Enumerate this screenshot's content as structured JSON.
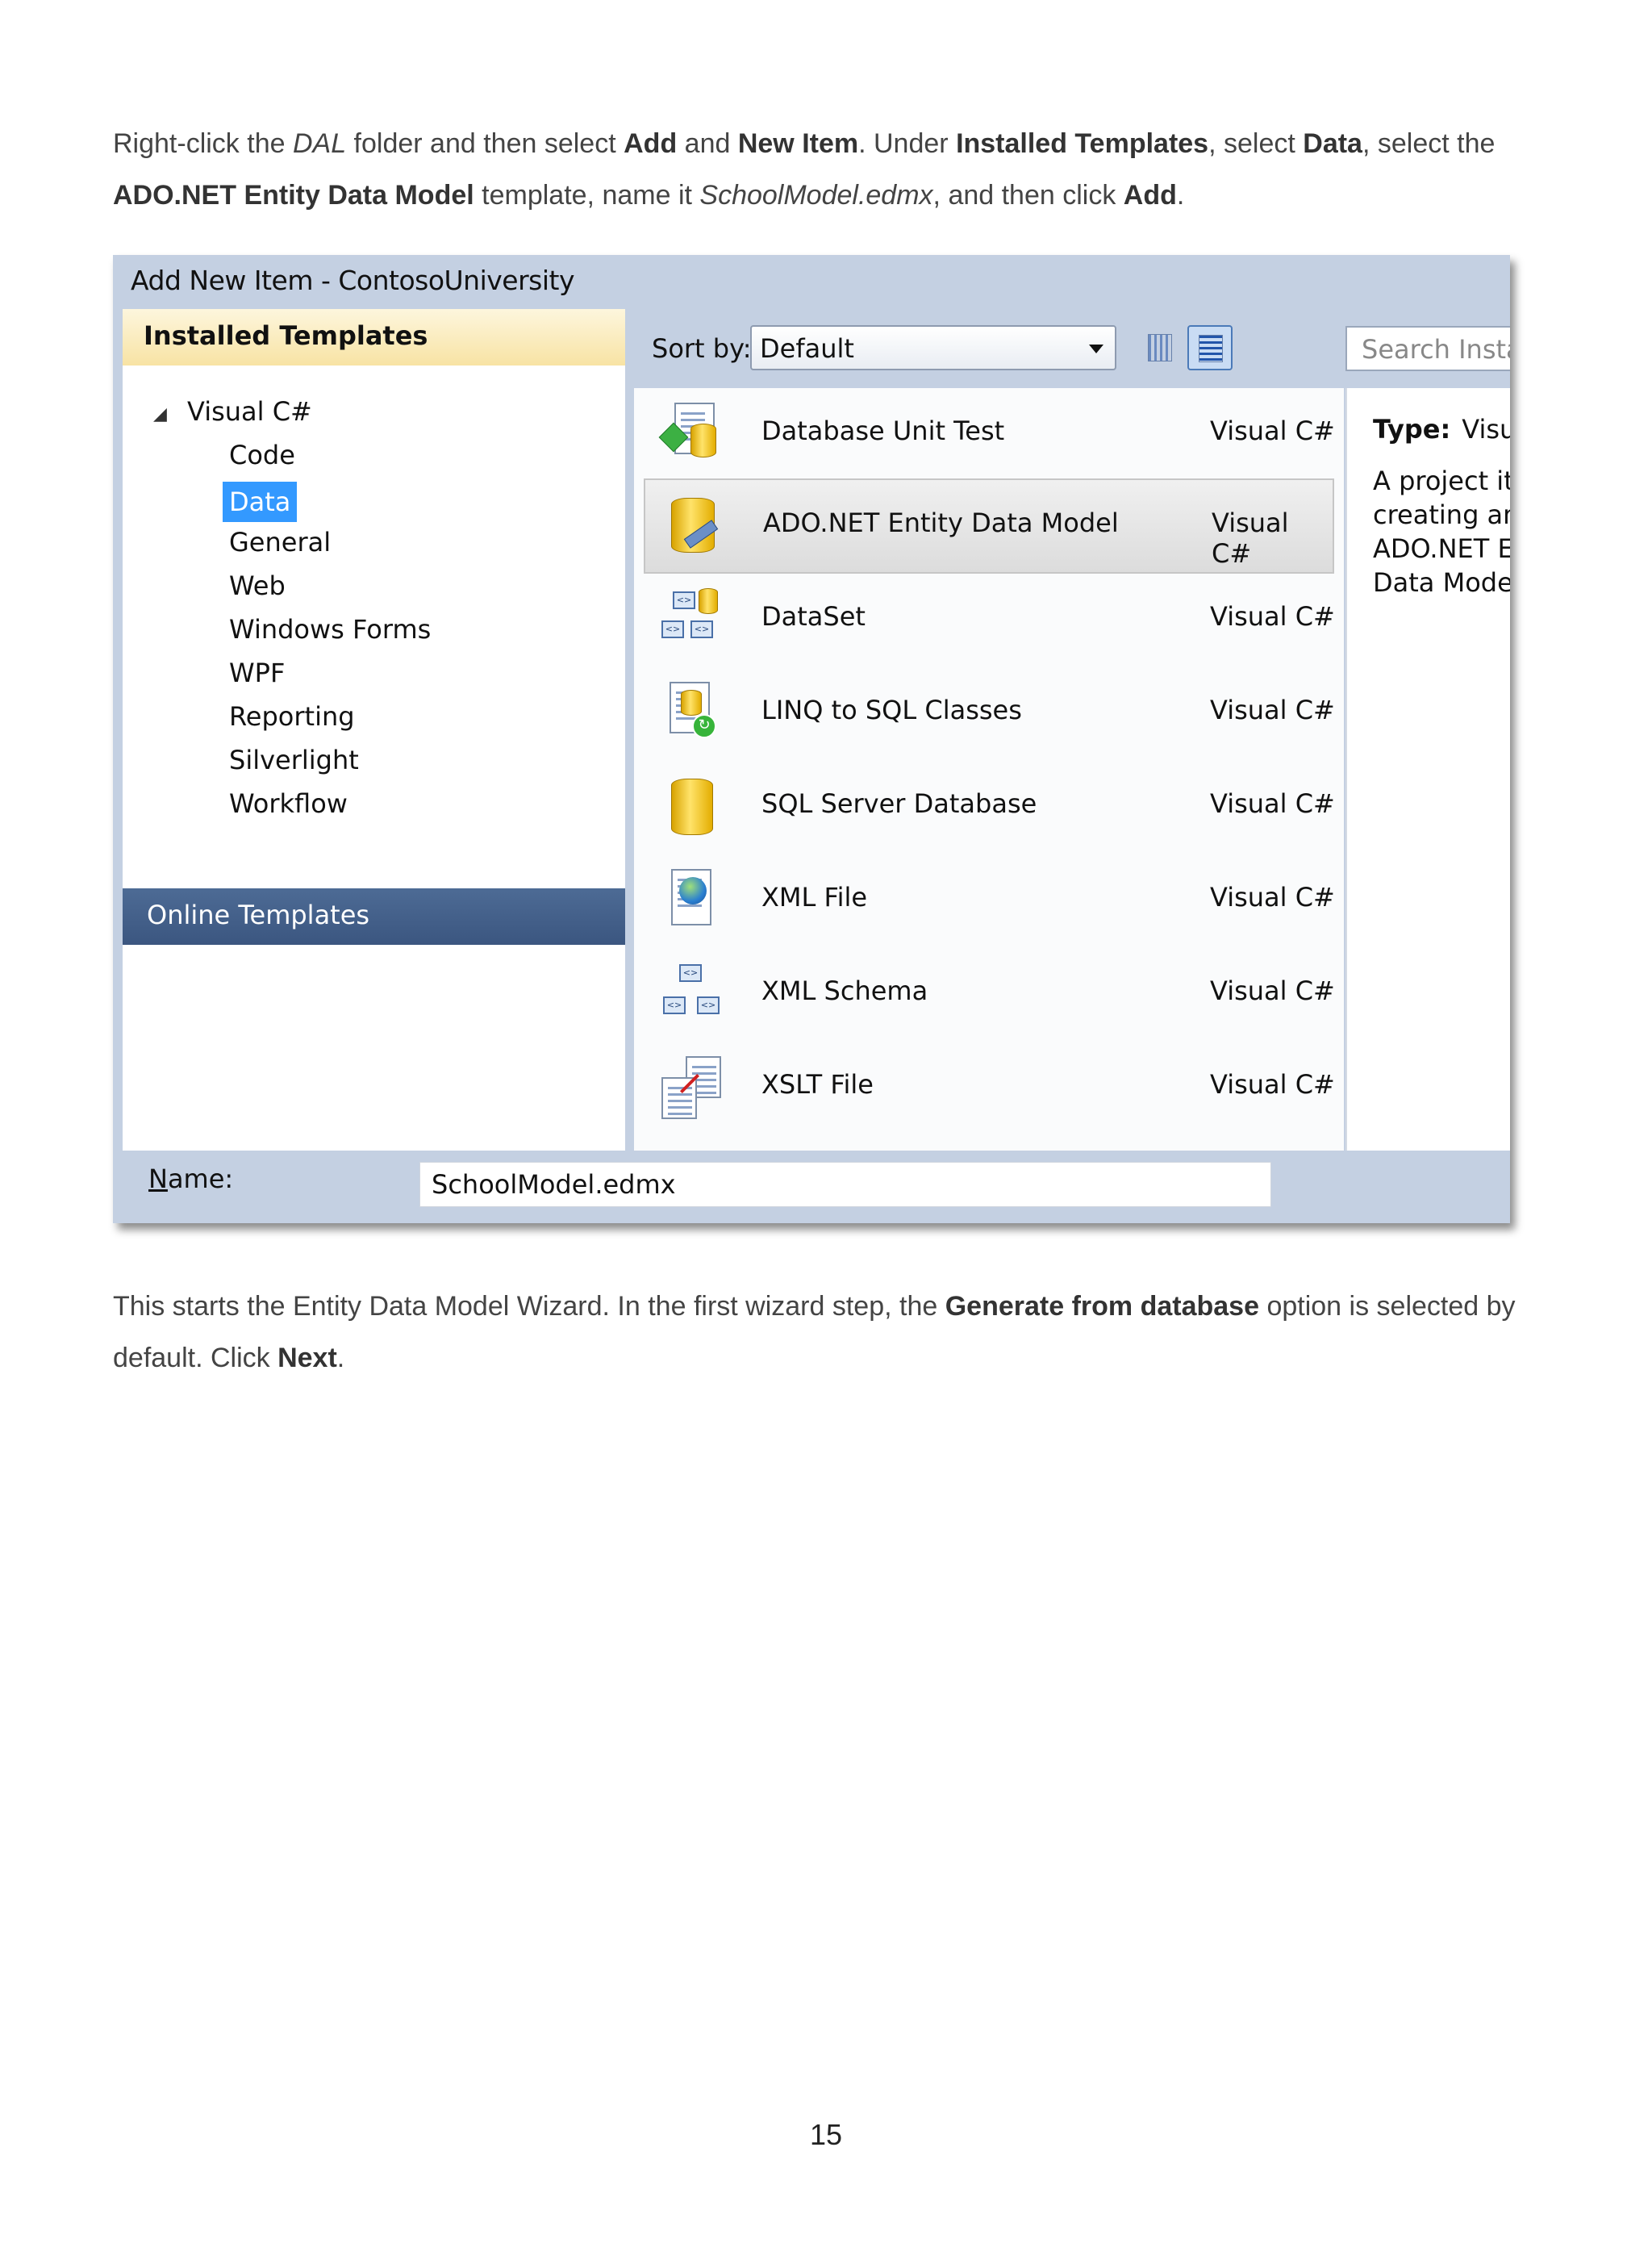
{
  "paragraph1": {
    "s1": "Right-click the ",
    "dal": "DAL",
    "s2": " folder and then select ",
    "add": "Add",
    "s3": " and ",
    "new_item": "New Item",
    "s4": ". Under ",
    "installed_templates": "Installed Templates",
    "s5": ", select ",
    "data": "Data",
    "s6": ", select the ",
    "ado": "ADO.NET Entity Data Model",
    "s7": " template, name it ",
    "filename": "SchoolModel.edmx",
    "s8": ", and then click ",
    "add2": "Add",
    "s9": "."
  },
  "dialog": {
    "title": "Add New Item - ContosoUniversity",
    "installed_header": "Installed Templates",
    "tree_root": "Visual C#",
    "tree_items": [
      "Code",
      "Data",
      "General",
      "Web",
      "Windows Forms",
      "WPF",
      "Reporting",
      "Silverlight",
      "Workflow"
    ],
    "selected_tree_item": "Data",
    "online_templates": "Online Templates",
    "sort_label": "Sort by:",
    "sort_value": "Default",
    "search_placeholder": "Search Installed Templates",
    "templates": [
      {
        "name": "Database Unit Test",
        "lang": "Visual C#",
        "icon": "database-unit-test-icon"
      },
      {
        "name": "ADO.NET Entity Data Model",
        "lang": "Visual C#",
        "icon": "entity-data-model-icon",
        "selected": true
      },
      {
        "name": "DataSet",
        "lang": "Visual C#",
        "icon": "dataset-icon"
      },
      {
        "name": "LINQ to SQL Classes",
        "lang": "Visual C#",
        "icon": "linq-to-sql-icon"
      },
      {
        "name": "SQL Server Database",
        "lang": "Visual C#",
        "icon": "sql-database-icon"
      },
      {
        "name": "XML File",
        "lang": "Visual C#",
        "icon": "xml-file-icon"
      },
      {
        "name": "XML Schema",
        "lang": "Visual C#",
        "icon": "xml-schema-icon"
      },
      {
        "name": "XSLT File",
        "lang": "Visual C#",
        "icon": "xslt-file-icon"
      }
    ],
    "detail_type_label": "Type:",
    "detail_type_value": "Visual C#",
    "detail_desc": "A project item for creating an ADO.NET Entity Data Model.",
    "name_label_underlined": "N",
    "name_label_rest": "ame:",
    "name_value": "SchoolModel.edmx"
  },
  "paragraph2": {
    "s1": "This starts the Entity Data Model Wizard. In the first wizard step, the ",
    "generate": "Generate from database",
    "s2": " option is selected by default. Click ",
    "next": "Next",
    "s3": "."
  },
  "page_number": "15"
}
